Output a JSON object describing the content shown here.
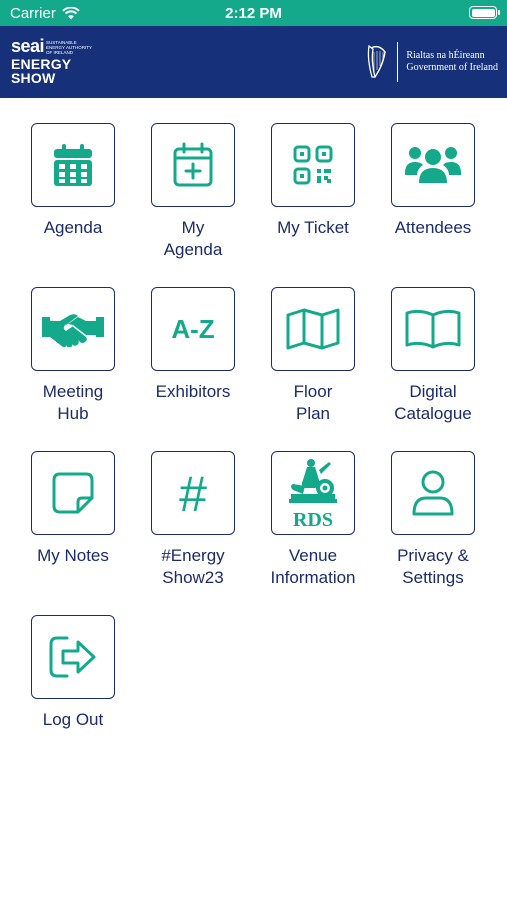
{
  "status_bar": {
    "carrier": "Carrier",
    "time": "2:12 PM"
  },
  "header": {
    "brand_seai": "seai",
    "brand_tagline": "SUSTAINABLE ENERGY AUTHORITY OF IRELAND",
    "brand_line1": "ENERGY",
    "brand_line2": "SHOW",
    "gov_line1": "Rialtas na hÉireann",
    "gov_line2": "Government of Ireland"
  },
  "colors": {
    "accent": "#14a98a",
    "header": "#16307a",
    "text": "#1b2b6b"
  },
  "menu": [
    {
      "label": "Agenda",
      "icon": "calendar-icon"
    },
    {
      "label": "My\nAgenda",
      "icon": "calendar-plus-icon"
    },
    {
      "label": "My Ticket",
      "icon": "qr-code-icon"
    },
    {
      "label": "Attendees",
      "icon": "people-icon"
    },
    {
      "label": "Meeting\nHub",
      "icon": "handshake-icon"
    },
    {
      "label": "Exhibitors",
      "icon": "a-z-icon",
      "icon_text": "A-Z"
    },
    {
      "label": "Floor\nPlan",
      "icon": "map-icon"
    },
    {
      "label": "Digital\nCatalogue",
      "icon": "book-icon"
    },
    {
      "label": "My Notes",
      "icon": "note-icon"
    },
    {
      "label": "#Energy\nShow23",
      "icon": "hashtag-icon",
      "icon_text": "#"
    },
    {
      "label": "Venue\nInformation",
      "icon": "rds-logo-icon",
      "icon_text": "RDS"
    },
    {
      "label": "Privacy &\nSettings",
      "icon": "user-icon"
    },
    {
      "label": "Log Out",
      "icon": "logout-icon"
    }
  ]
}
